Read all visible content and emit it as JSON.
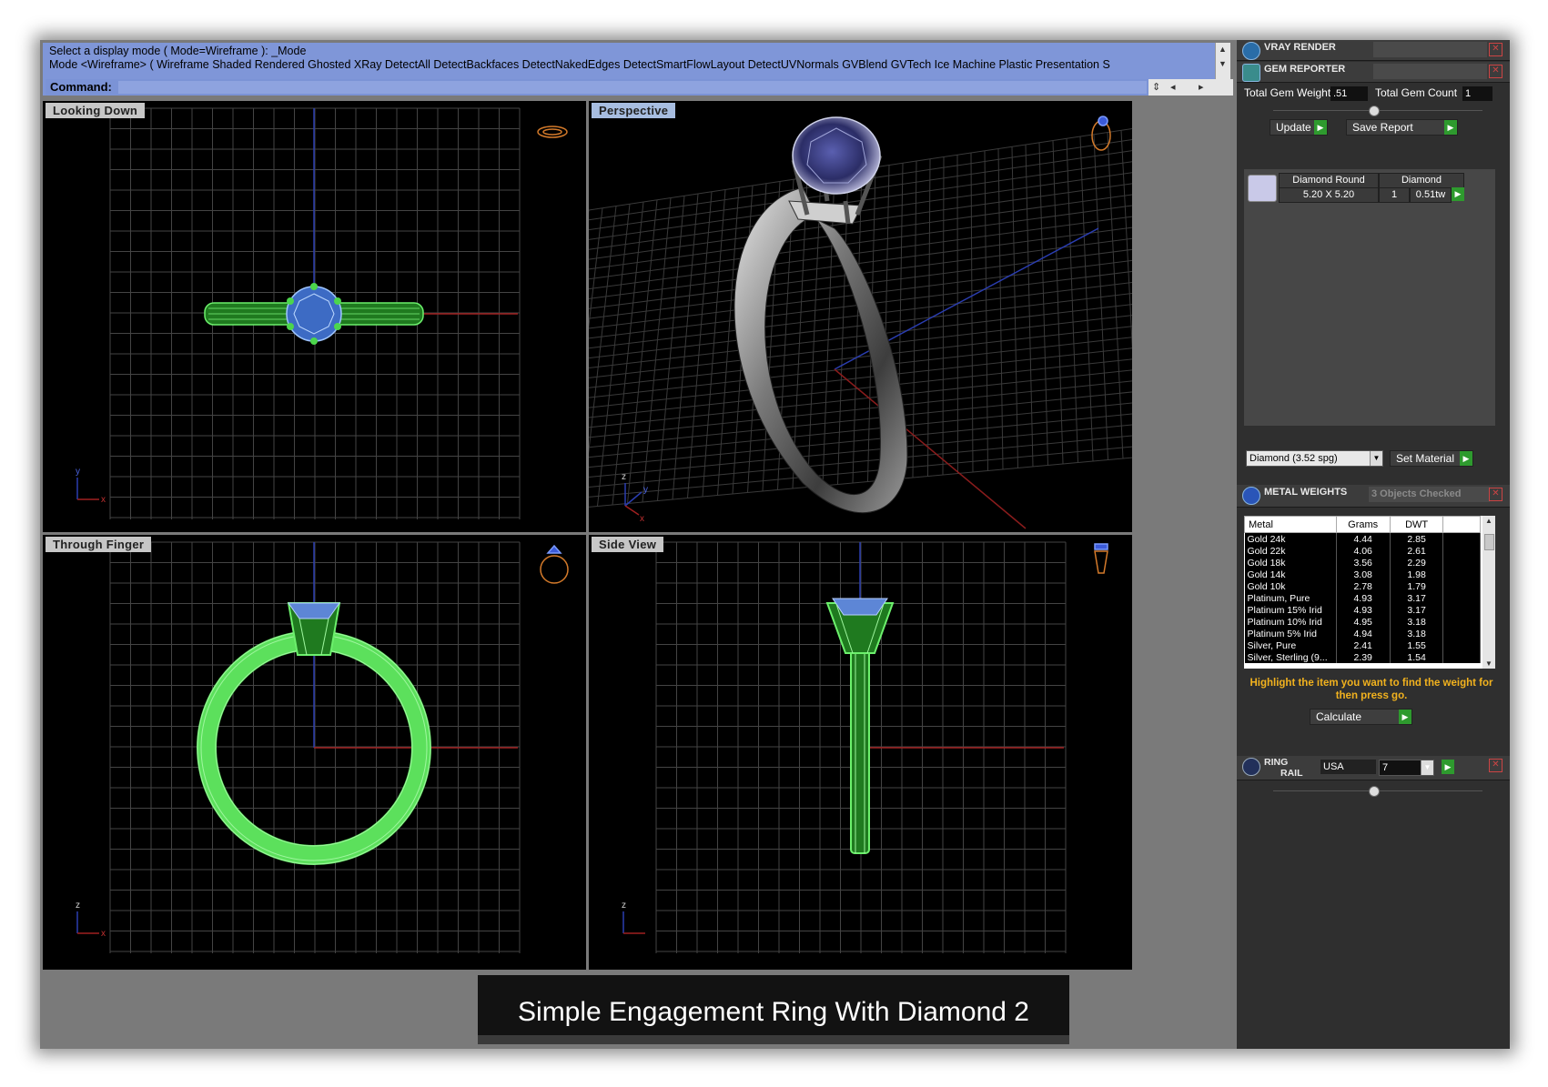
{
  "command": {
    "line1": "Select a display mode ( Mode=Wireframe ): _Mode",
    "line2": "Mode <Wireframe> ( Wireframe  Shaded  Rendered  Ghosted  XRay  DetectAll  DetectBackfaces  DetectNakedEdges  DetectSmartFlowLayout  DetectUVNormals  GVBlend  GVTech  Ice  Machine  Plastic  Presentation  S",
    "prompt": "Command:"
  },
  "viewports": {
    "top_left": "Looking Down",
    "top_right": "Perspective",
    "bottom_left": "Through Finger",
    "bottom_right": "Side View"
  },
  "axes": {
    "x": "x",
    "y": "y",
    "z": "z"
  },
  "caption": "Simple Engagement Ring With Diamond 2",
  "panel": {
    "vray_title": "VRAY RENDER",
    "gem_reporter": {
      "title": "GEM REPORTER",
      "total_weight_label": "Total Gem Weight",
      "total_weight": ".51",
      "total_count_label": "Total Gem Count",
      "total_count": "1",
      "update": "Update",
      "save_report": "Save Report",
      "gem": {
        "shape": "Diamond Round",
        "size": "5.20 X 5.20",
        "type": "Diamond",
        "qty": "1",
        "weight": "0.51tw"
      },
      "material_select": "Diamond    (3.52 spg)",
      "set_material": "Set Material"
    },
    "metal_weights": {
      "title": "METAL WEIGHTS",
      "checked": "3 Objects Checked",
      "headers": [
        "Metal",
        "Grams",
        "DWT"
      ],
      "rows": [
        [
          "Gold 24k",
          "4.44",
          "2.85"
        ],
        [
          "Gold 22k",
          "4.06",
          "2.61"
        ],
        [
          "Gold 18k",
          "3.56",
          "2.29"
        ],
        [
          "Gold 14k",
          "3.08",
          "1.98"
        ],
        [
          "Gold 10k",
          "2.78",
          "1.79"
        ],
        [
          "Platinum, Pure",
          "4.93",
          "3.17"
        ],
        [
          "Platinum 15% Irid",
          "4.93",
          "3.17"
        ],
        [
          "Platinum 10% Irid",
          "4.95",
          "3.18"
        ],
        [
          "Platinum 5% Irid",
          "4.94",
          "3.18"
        ],
        [
          "Silver, Pure",
          "2.41",
          "1.55"
        ],
        [
          "Silver, Sterling (9...",
          "2.39",
          "1.54"
        ]
      ],
      "hint": "Highlight the item you want to find the weight for then press go.",
      "calculate": "Calculate"
    },
    "ring_rail": {
      "title_line1": "RING",
      "title_line2": "RAIL",
      "standard": "USA",
      "size": "7"
    }
  }
}
